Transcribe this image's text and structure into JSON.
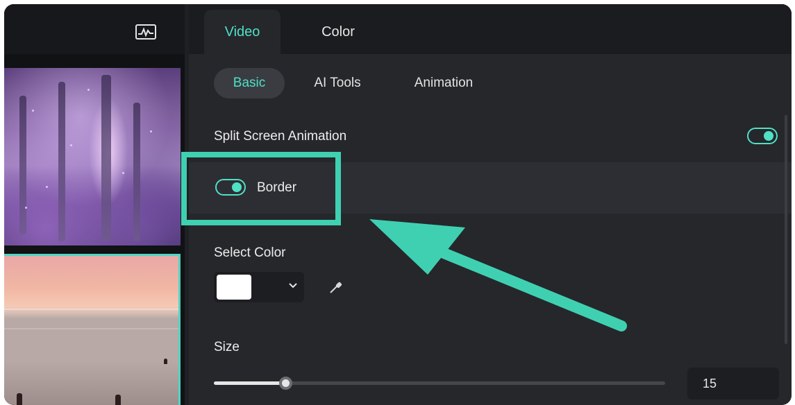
{
  "top_tabs": [
    {
      "label": "Video",
      "active": true
    },
    {
      "label": "Color",
      "active": false
    }
  ],
  "sub_tabs": [
    {
      "label": "Basic",
      "active": true
    },
    {
      "label": "AI Tools",
      "active": false
    },
    {
      "label": "Animation",
      "active": false
    }
  ],
  "split_screen": {
    "label": "Split Screen Animation",
    "enabled": true
  },
  "border": {
    "label": "Border",
    "enabled": true
  },
  "select_color": {
    "label": "Select Color",
    "value": "#FFFFFF"
  },
  "size": {
    "label": "Size",
    "value": "15",
    "slider_fraction": 0.16
  },
  "icons": {
    "waveform": "waveform-icon",
    "dropdown": "chevron-down-icon",
    "eyedropper": "eyedropper-icon"
  },
  "colors": {
    "accent": "#4FE0C6",
    "callout": "#3FD0B2",
    "panel": "#26272B"
  }
}
